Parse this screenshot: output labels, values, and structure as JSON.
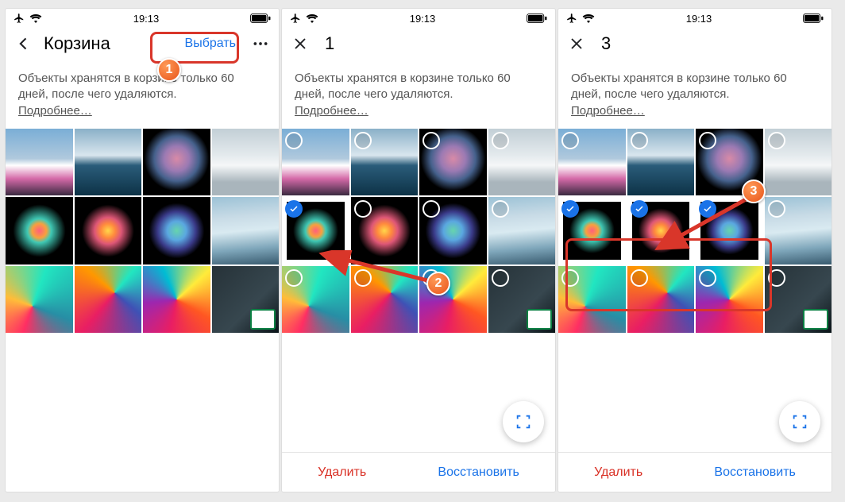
{
  "status": {
    "time": "19:13"
  },
  "s1": {
    "title": "Корзина",
    "select": "Выбрать",
    "info": "Объекты хранятся в корзине только 60 дней, после чего удаляются.",
    "more": "Подробнее…"
  },
  "s2": {
    "count": "1",
    "info": "Объекты хранятся в корзине только 60 дней, после чего удаляются.",
    "more": "Подробнее…",
    "delete": "Удалить",
    "restore": "Восстановить"
  },
  "s3": {
    "count": "3",
    "info": "Объекты хранятся в корзине только 60 дней, после чего удаляются.",
    "more": "Подробнее…",
    "delete": "Удалить",
    "restore": "Восстановить"
  },
  "badges": {
    "b1": "1",
    "b2": "2",
    "b3": "3"
  }
}
